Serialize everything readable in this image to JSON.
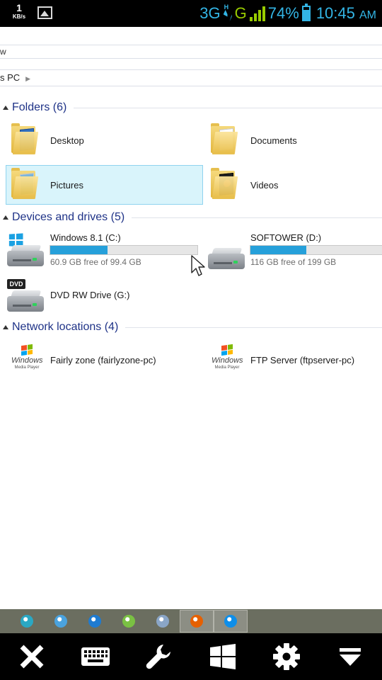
{
  "status_bar": {
    "speed_value": "1",
    "speed_unit": "KB/s",
    "network_type": "3G",
    "network_sub": "H",
    "network_alt": "G",
    "battery_percent": "74%",
    "time": "10:45",
    "ampm": "AM",
    "accent_color": "#33b5e5",
    "signal_color": "#99cc00"
  },
  "ribbon": {
    "partial_label": "w"
  },
  "address_bar": {
    "location": "s PC"
  },
  "folders": {
    "header": "Folders (6)",
    "items": [
      {
        "label": "Desktop",
        "icon": "folder-desktop-icon"
      },
      {
        "label": "Documents",
        "icon": "folder-documents-icon"
      },
      {
        "label": "Pictures",
        "icon": "folder-pictures-icon",
        "selected": true
      },
      {
        "label": "Videos",
        "icon": "folder-videos-icon"
      }
    ]
  },
  "devices": {
    "header": "Devices and drives (5)",
    "items": [
      {
        "label": "Windows 8.1 (C:)",
        "free_text": "60.9 GB free of 99.4 GB",
        "used_fraction": 0.39,
        "icon": "windows-drive-icon"
      },
      {
        "label": "SOFTOWER (D:)",
        "free_text": "116 GB free of 199 GB",
        "used_fraction": 0.42,
        "icon": "hard-drive-icon"
      },
      {
        "label": "DVD RW Drive (G:)",
        "icon": "dvd-drive-icon",
        "badge": "DVD"
      }
    ]
  },
  "network": {
    "header": "Network locations (4)",
    "items": [
      {
        "label": "Fairly zone (fairlyzone-pc)",
        "logo_text": "Windows",
        "logo_sub": "Media Player"
      },
      {
        "label": "FTP Server (ftpserver-pc)",
        "logo_text": "Windows",
        "logo_sub": "Media Player"
      }
    ]
  },
  "taskbar": {
    "items": [
      {
        "icon": "arduino-icon",
        "color": "#2aa8c4"
      },
      {
        "icon": "network-globe-icon",
        "color": "#4aa3df"
      },
      {
        "icon": "ie-browser-icon",
        "color": "#1e7bd1"
      },
      {
        "icon": "utorrent-icon",
        "color": "#7ac143"
      },
      {
        "icon": "compass-icon",
        "color": "#8aa6c7"
      },
      {
        "icon": "firefox-icon",
        "color": "#e66000",
        "active": true
      },
      {
        "icon": "teamviewer-icon",
        "color": "#0e8ee9",
        "active": true
      }
    ],
    "bg_color": "#6b6e60"
  },
  "toolbar": {
    "items": [
      {
        "icon": "close-icon"
      },
      {
        "icon": "keyboard-icon"
      },
      {
        "icon": "wrench-icon"
      },
      {
        "icon": "windows-logo-icon"
      },
      {
        "icon": "settings-gear-icon"
      },
      {
        "icon": "collapse-triangle-icon"
      }
    ]
  }
}
